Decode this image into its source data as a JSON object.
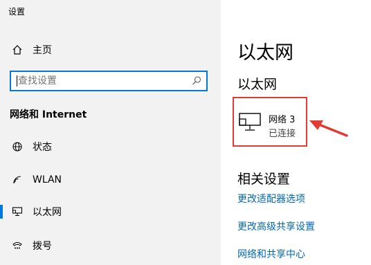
{
  "app": {
    "title": "设置"
  },
  "sidebar": {
    "home_label": "主页",
    "search": {
      "placeholder": "查找设置"
    },
    "section_heading": "网络和 Internet",
    "items": [
      {
        "label": "状态",
        "icon": "globe-icon"
      },
      {
        "label": "WLAN",
        "icon": "wifi-icon"
      },
      {
        "label": "以太网",
        "icon": "ethernet-icon",
        "selected": true
      },
      {
        "label": "拨号",
        "icon": "dialup-icon"
      }
    ]
  },
  "main": {
    "title": "以太网",
    "subtitle": "以太网",
    "network": {
      "name": "网络 3",
      "status": "已连接",
      "icon": "ethernet-monitor-icon"
    },
    "related_title": "相关设置",
    "links": [
      "更改适配器选项",
      "更改高级共享设置",
      "网络和共享中心"
    ]
  },
  "colors": {
    "accent": "#0078d7",
    "link": "#0067b8",
    "highlight": "#e53935",
    "sidebar_bg": "#f2f2f2"
  }
}
